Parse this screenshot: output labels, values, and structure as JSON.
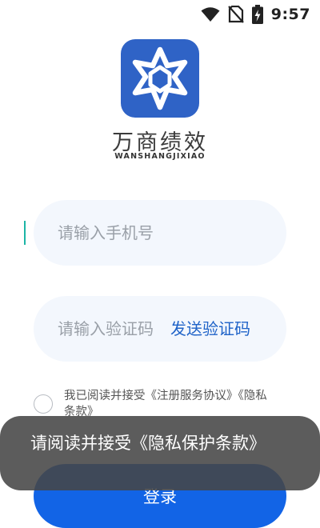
{
  "status_bar": {
    "time": "9:57",
    "icons": [
      "wifi-icon",
      "no-sim-icon",
      "battery-charging-icon"
    ]
  },
  "brand": {
    "name_cn": "万商绩效",
    "name_en": "WANSHANGJIXIAO",
    "logo_icon": "star-logo-icon",
    "logo_color": "#2f63c6"
  },
  "phone": {
    "placeholder": "请输入手机号",
    "value": ""
  },
  "verify_code": {
    "placeholder": "请输入验证码",
    "value": "",
    "send_label": "发送验证码"
  },
  "agreement": {
    "checked": false,
    "line1": "我已阅读并接受《注册服务协议》《隐私",
    "line2": "条款》"
  },
  "login": {
    "label": "登录"
  },
  "toast": {
    "message": "请阅读并接受《隐私保护条款》"
  },
  "colors": {
    "accent": "#1264e6",
    "link": "#1f63c8",
    "field_bg": "#f3f7fd",
    "toast_bg": "#464646"
  }
}
